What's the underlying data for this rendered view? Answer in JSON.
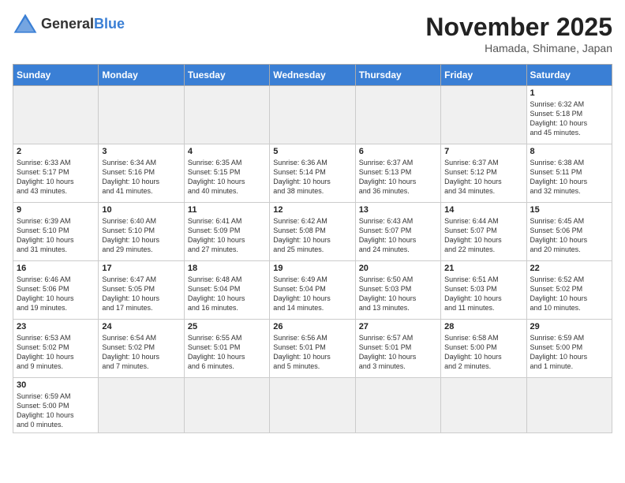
{
  "header": {
    "logo_general": "General",
    "logo_blue": "Blue",
    "month_title": "November 2025",
    "location": "Hamada, Shimane, Japan"
  },
  "weekdays": [
    "Sunday",
    "Monday",
    "Tuesday",
    "Wednesday",
    "Thursday",
    "Friday",
    "Saturday"
  ],
  "days": [
    {
      "date": "",
      "info": ""
    },
    {
      "date": "",
      "info": ""
    },
    {
      "date": "",
      "info": ""
    },
    {
      "date": "",
      "info": ""
    },
    {
      "date": "",
      "info": ""
    },
    {
      "date": "",
      "info": ""
    },
    {
      "date": "1",
      "info": "Sunrise: 6:32 AM\nSunset: 5:18 PM\nDaylight: 10 hours\nand 45 minutes."
    },
    {
      "date": "2",
      "info": "Sunrise: 6:33 AM\nSunset: 5:17 PM\nDaylight: 10 hours\nand 43 minutes."
    },
    {
      "date": "3",
      "info": "Sunrise: 6:34 AM\nSunset: 5:16 PM\nDaylight: 10 hours\nand 41 minutes."
    },
    {
      "date": "4",
      "info": "Sunrise: 6:35 AM\nSunset: 5:15 PM\nDaylight: 10 hours\nand 40 minutes."
    },
    {
      "date": "5",
      "info": "Sunrise: 6:36 AM\nSunset: 5:14 PM\nDaylight: 10 hours\nand 38 minutes."
    },
    {
      "date": "6",
      "info": "Sunrise: 6:37 AM\nSunset: 5:13 PM\nDaylight: 10 hours\nand 36 minutes."
    },
    {
      "date": "7",
      "info": "Sunrise: 6:37 AM\nSunset: 5:12 PM\nDaylight: 10 hours\nand 34 minutes."
    },
    {
      "date": "8",
      "info": "Sunrise: 6:38 AM\nSunset: 5:11 PM\nDaylight: 10 hours\nand 32 minutes."
    },
    {
      "date": "9",
      "info": "Sunrise: 6:39 AM\nSunset: 5:10 PM\nDaylight: 10 hours\nand 31 minutes."
    },
    {
      "date": "10",
      "info": "Sunrise: 6:40 AM\nSunset: 5:10 PM\nDaylight: 10 hours\nand 29 minutes."
    },
    {
      "date": "11",
      "info": "Sunrise: 6:41 AM\nSunset: 5:09 PM\nDaylight: 10 hours\nand 27 minutes."
    },
    {
      "date": "12",
      "info": "Sunrise: 6:42 AM\nSunset: 5:08 PM\nDaylight: 10 hours\nand 25 minutes."
    },
    {
      "date": "13",
      "info": "Sunrise: 6:43 AM\nSunset: 5:07 PM\nDaylight: 10 hours\nand 24 minutes."
    },
    {
      "date": "14",
      "info": "Sunrise: 6:44 AM\nSunset: 5:07 PM\nDaylight: 10 hours\nand 22 minutes."
    },
    {
      "date": "15",
      "info": "Sunrise: 6:45 AM\nSunset: 5:06 PM\nDaylight: 10 hours\nand 20 minutes."
    },
    {
      "date": "16",
      "info": "Sunrise: 6:46 AM\nSunset: 5:06 PM\nDaylight: 10 hours\nand 19 minutes."
    },
    {
      "date": "17",
      "info": "Sunrise: 6:47 AM\nSunset: 5:05 PM\nDaylight: 10 hours\nand 17 minutes."
    },
    {
      "date": "18",
      "info": "Sunrise: 6:48 AM\nSunset: 5:04 PM\nDaylight: 10 hours\nand 16 minutes."
    },
    {
      "date": "19",
      "info": "Sunrise: 6:49 AM\nSunset: 5:04 PM\nDaylight: 10 hours\nand 14 minutes."
    },
    {
      "date": "20",
      "info": "Sunrise: 6:50 AM\nSunset: 5:03 PM\nDaylight: 10 hours\nand 13 minutes."
    },
    {
      "date": "21",
      "info": "Sunrise: 6:51 AM\nSunset: 5:03 PM\nDaylight: 10 hours\nand 11 minutes."
    },
    {
      "date": "22",
      "info": "Sunrise: 6:52 AM\nSunset: 5:02 PM\nDaylight: 10 hours\nand 10 minutes."
    },
    {
      "date": "23",
      "info": "Sunrise: 6:53 AM\nSunset: 5:02 PM\nDaylight: 10 hours\nand 9 minutes."
    },
    {
      "date": "24",
      "info": "Sunrise: 6:54 AM\nSunset: 5:02 PM\nDaylight: 10 hours\nand 7 minutes."
    },
    {
      "date": "25",
      "info": "Sunrise: 6:55 AM\nSunset: 5:01 PM\nDaylight: 10 hours\nand 6 minutes."
    },
    {
      "date": "26",
      "info": "Sunrise: 6:56 AM\nSunset: 5:01 PM\nDaylight: 10 hours\nand 5 minutes."
    },
    {
      "date": "27",
      "info": "Sunrise: 6:57 AM\nSunset: 5:01 PM\nDaylight: 10 hours\nand 3 minutes."
    },
    {
      "date": "28",
      "info": "Sunrise: 6:58 AM\nSunset: 5:00 PM\nDaylight: 10 hours\nand 2 minutes."
    },
    {
      "date": "29",
      "info": "Sunrise: 6:59 AM\nSunset: 5:00 PM\nDaylight: 10 hours\nand 1 minute."
    },
    {
      "date": "30",
      "info": "Sunrise: 6:59 AM\nSunset: 5:00 PM\nDaylight: 10 hours\nand 0 minutes."
    },
    {
      "date": "",
      "info": ""
    },
    {
      "date": "",
      "info": ""
    },
    {
      "date": "",
      "info": ""
    },
    {
      "date": "",
      "info": ""
    },
    {
      "date": "",
      "info": ""
    },
    {
      "date": "",
      "info": ""
    }
  ]
}
